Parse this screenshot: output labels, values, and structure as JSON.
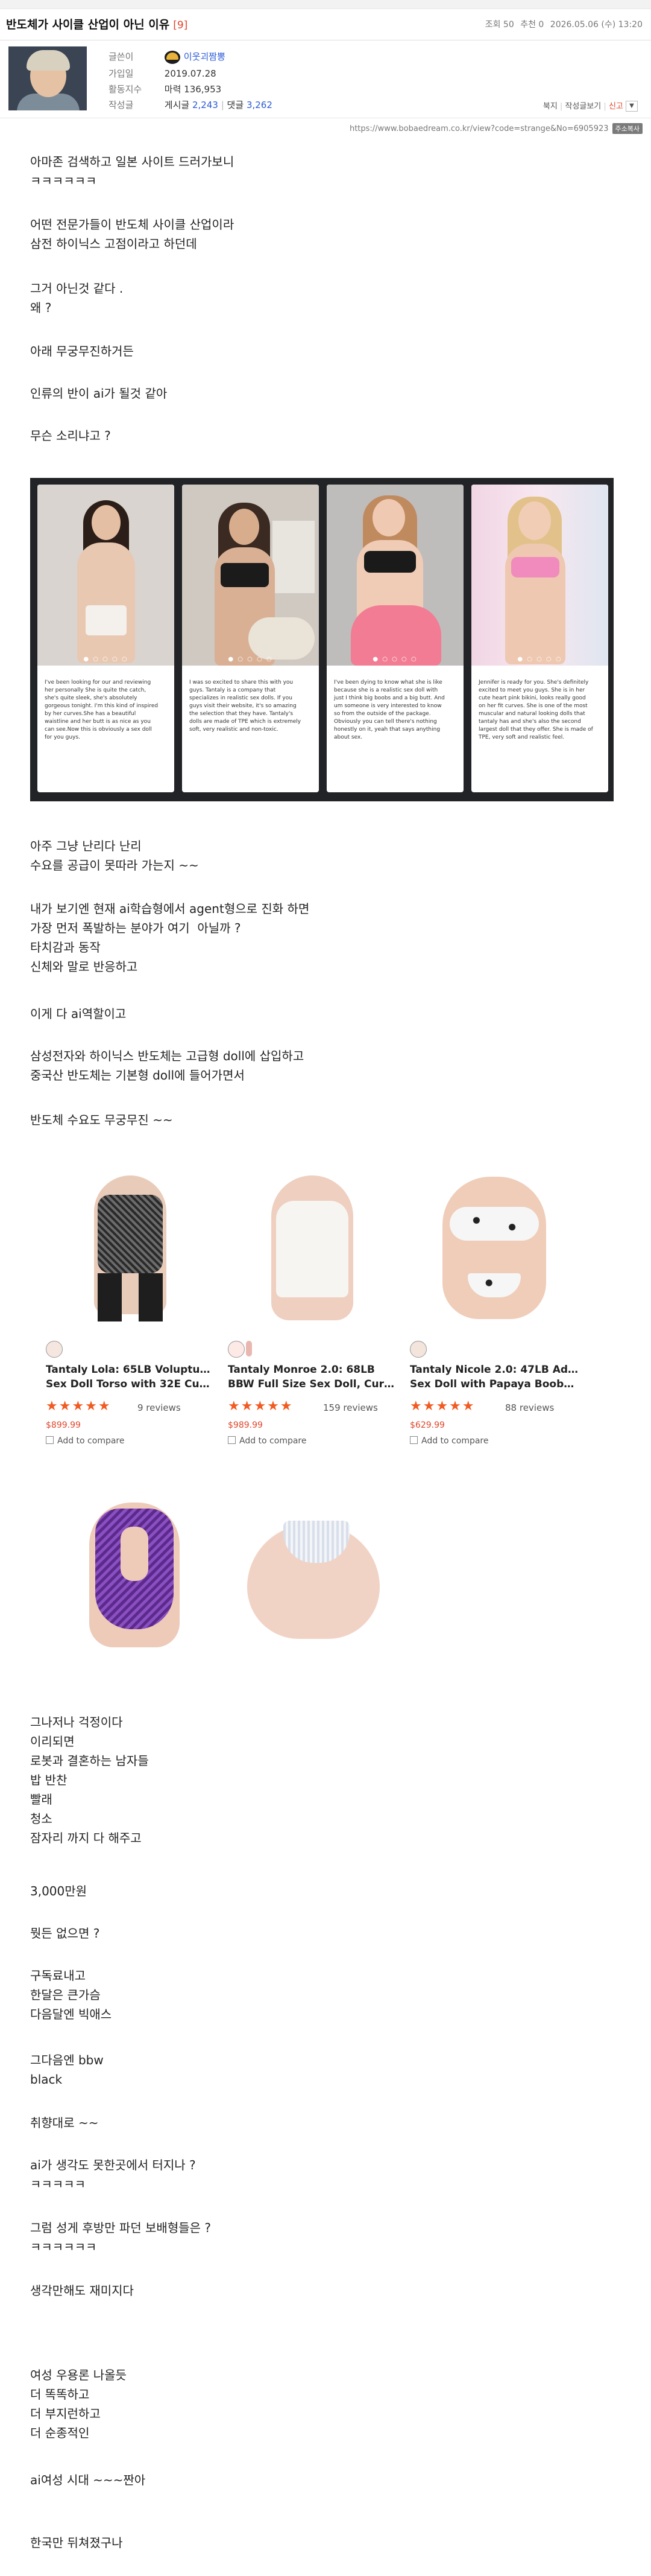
{
  "post": {
    "title": "반도체가 사이클 산업이 아닌 이유",
    "comment_count": "[9]",
    "views": "조회 50",
    "recommend": "추천 0",
    "datetime": "2026.05.06 (수) 13:20"
  },
  "author": {
    "labels": {
      "writer": "글쓴이",
      "joined": "가입일",
      "points": "활동지수",
      "posts": "작성글"
    },
    "nickname": "이웃괴짬뽕",
    "joined": "2019.07.28",
    "points": "마력 136,953",
    "posts_label": "게시글",
    "posts_count": "2,243",
    "comments_label": "댓글",
    "comments_count": "3,262"
  },
  "links": {
    "bookmark": "북지",
    "author_posts": "작성글보기",
    "report": "신고",
    "more": "▼"
  },
  "url": "https://www.bobaedream.co.kr/view?code=strange&No=6905923",
  "copy_label": "주소복사",
  "paragraphs": [
    "아마존 검색하고 일본 사이트 드러가보니\nㅋㅋㅋㅋㅋㅋ",
    "어떤 전문가들이 반도체 사이클 산업이라\n삼전 하이닉스 고점이라고 하던데",
    "그거 아닌것 같다 .\n왜 ?",
    "아래 무궁무진하거든",
    "인류의 반이 ai가 될것 같아",
    "무슨 소리냐고 ?",
    "아주 그냥 난리다 난리\n수요를 공급이 못따라 가는지 ~~",
    "내가 보기엔 현재 ai학습형에서 agent형으로 진화 하면\n가장 먼저 폭발하는 분야가 여기  아닐까 ?\n타치감과 동작\n신체와 말로 반응하고",
    "이게 다 ai역할이고",
    "삼성전자와 하이닉스 반도체는 고급형 doll에 삽입하고\n중국산 반도체는 기본형 doll에 들어가면서",
    "반도체 수요도 무궁무진 ~~",
    "그나저나 걱정이다\n이리되면\n로봇과 결혼하는 남자들\n밥 반찬\n빨래\n청소\n잠자리 까지 다 해주고",
    "3,000만원",
    "뭣든 없으면 ?",
    "구독료내고\n한달은 큰가슴\n다음달엔 빅애스",
    "그다음엔 bbw\nblack",
    "취향대로 ~~",
    "ai가 생각도 못한곳에서 터지나 ?\nㅋㅋㅋㅋㅋ",
    "그럼 성게 후방만 파던 보배형들은 ?\nㅋㅋㅋㅋㅋㅋ",
    "생각만해도 재미지다",
    "여성 우용론 나올듯\n더 똑똑하고\n더 부지런하고\n더 순종적인",
    "ai여성 시대 ~~~짠아",
    "한국만 뒤쳐졌구나"
  ],
  "carousel": {
    "dots": "● ○ ○ ○ ○",
    "cards": [
      {
        "desc": "I've been looking for our and reviewing her personally She is quite the catch, she's quite sleek, she's absolutely gorgeous tonight. I'm this kind of inspired by her curves.She has a beautiful waistline and her butt is as nice as you can see.Now this is obviously a sex doll for you guys."
      },
      {
        "desc": "I was so excited to share this with you guys. Tantaly is a company that specializes in realistic sex dolls. If you guys visit their website, it's so amazing the selection that they have. Tantaly's dolls are made of TPE which is extremely soft, very realistic and non-toxic."
      },
      {
        "desc": "I've been dying to know what she is like because she is a realistic sex doll with just I think big boobs and a big butt. And um someone is very interested to know so from the outside of the package. Obviously you can tell there's nothing honestly on it, yeah that says anything about sex."
      },
      {
        "desc": "Jennifer is ready for you. She's definitely excited to meet you guys. She is in her cute heart pink bikini, looks really good on her fit curves. She is one of the most muscular and natural looking dolls that tantaly has and she's also the second largest doll that they offer. She is made of TPE, very soft and realistic feel."
      }
    ]
  },
  "products": [
    {
      "name_line1": "Tantaly Lola: 65LB Voluptuous",
      "name_line2": "Sex Doll Torso with 32E Cup ...",
      "stars": "★★★★★",
      "reviews": "9 reviews",
      "price": "$899.99",
      "compare": "Add to compare"
    },
    {
      "name_line1": "Tantaly Monroe 2.0: 68LB",
      "name_line2": "BBW Full Size Sex Doll, Curv...",
      "stars": "★★★★★",
      "reviews": "159 reviews",
      "price": "$989.99",
      "compare": "Add to compare"
    },
    {
      "name_line1": "Tantaly Nicole 2.0: 47LB Adult",
      "name_line2": "Sex Doll with Papaya Boobs...",
      "stars": "★★★★★",
      "reviews": "88 reviews",
      "price": "$629.99",
      "compare": "Add to compare"
    }
  ],
  "colors": {
    "accent_red": "#e0452b",
    "link_blue": "#2a5bd7",
    "star_orange": "#f15a22"
  }
}
